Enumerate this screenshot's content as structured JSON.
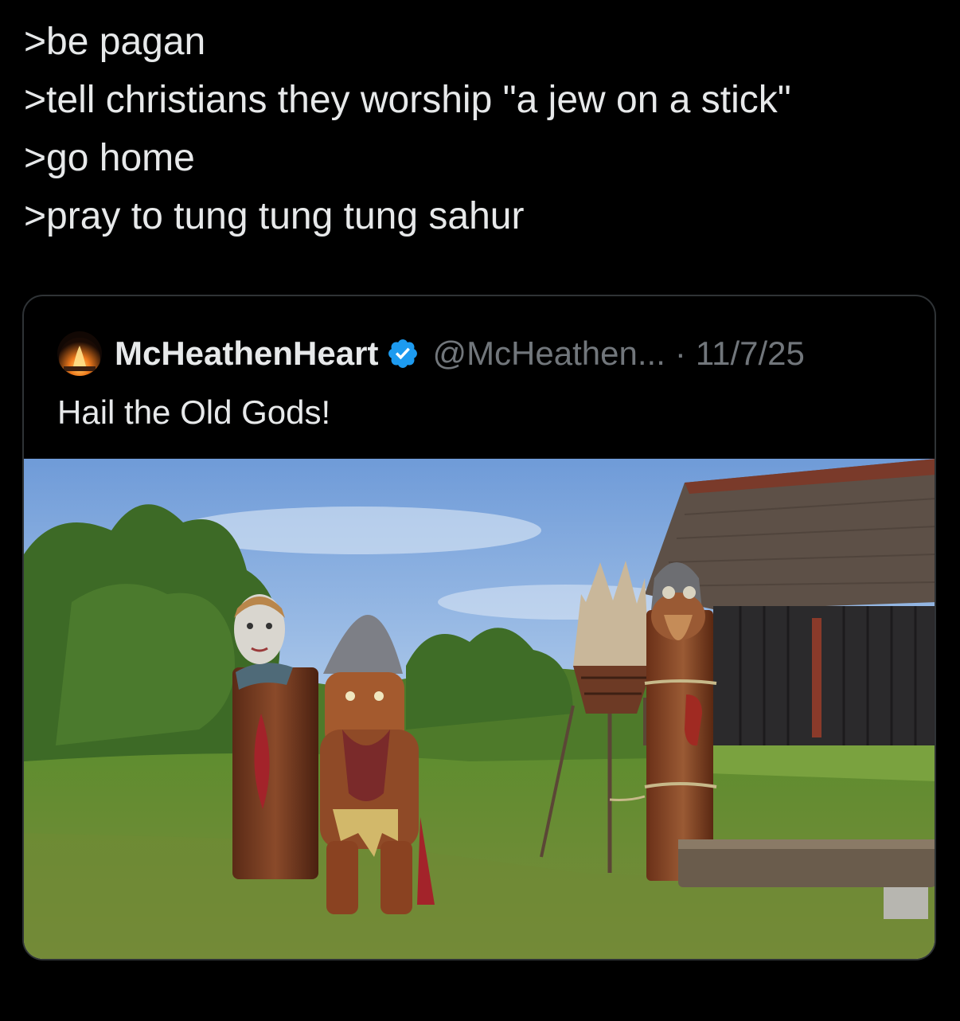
{
  "post": {
    "lines": [
      ">be pagan",
      ">tell christians they worship \"a jew on a stick\"",
      ">go home",
      ">pray to tung tung tung sahur"
    ]
  },
  "quote": {
    "avatar_icon": "bonfire-avatar",
    "display_name": "McHeathenHeart",
    "verified_icon": "verified-badge-icon",
    "handle": "@McHeathen...",
    "separator": "·",
    "date": "11/7/25",
    "text": "Hail the Old Gods!",
    "media_icon": "photo-carved-wooden-idols",
    "accent_color": "#1d9bf0"
  }
}
